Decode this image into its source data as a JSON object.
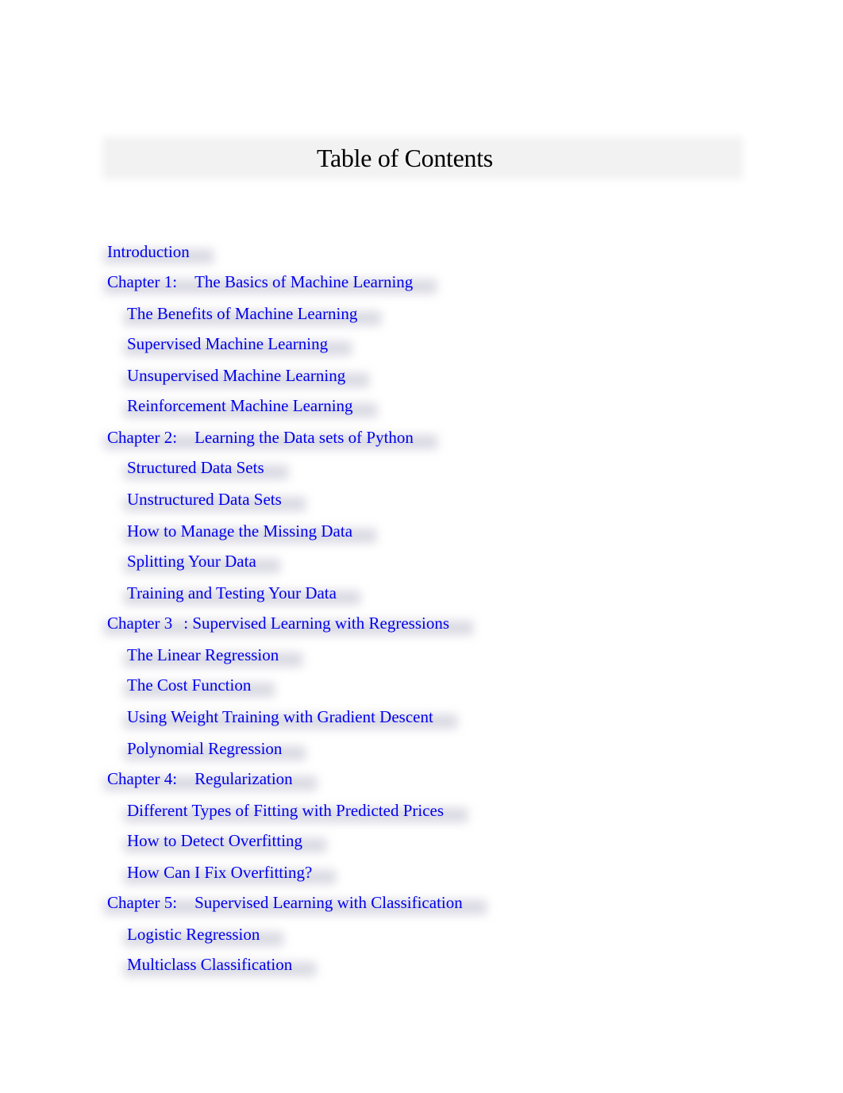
{
  "title": "Table of Contents",
  "link_color": "#0000ee",
  "entries": [
    {
      "level": 1,
      "label": "Introduction"
    },
    {
      "level": 1,
      "prefix": "Chapter 1:",
      "label": "The Basics of Machine Learning"
    },
    {
      "level": 2,
      "label": "The Benefits of Machine Learning"
    },
    {
      "level": 2,
      "label": "Supervised Machine Learning"
    },
    {
      "level": 2,
      "label": "Unsupervised Machine Learning"
    },
    {
      "level": 2,
      "label": "Reinforcement Machine Learning"
    },
    {
      "level": 1,
      "prefix": "Chapter 2:",
      "label": "Learning the Data sets of Python"
    },
    {
      "level": 2,
      "label": "Structured Data Sets"
    },
    {
      "level": 2,
      "label": "Unstructured Data Sets"
    },
    {
      "level": 2,
      "label": "How to Manage the Missing Data"
    },
    {
      "level": 2,
      "label": "Splitting Your Data"
    },
    {
      "level": 2,
      "label": "Training and Testing Your Data"
    },
    {
      "level": 1,
      "prefix": "Chapter 3",
      "label": ": Supervised Learning with Regressions"
    },
    {
      "level": 2,
      "label": "The Linear Regression"
    },
    {
      "level": 2,
      "label": "The Cost Function"
    },
    {
      "level": 2,
      "label": "Using Weight Training with Gradient Descent"
    },
    {
      "level": 2,
      "label": "Polynomial Regression"
    },
    {
      "level": 1,
      "prefix": "Chapter 4:",
      "label": "Regularization"
    },
    {
      "level": 2,
      "label": "Different Types of Fitting with Predicted Prices"
    },
    {
      "level": 2,
      "label": "How to Detect Overfitting"
    },
    {
      "level": 2,
      "label": "How Can I Fix Overfitting?"
    },
    {
      "level": 1,
      "prefix": "Chapter 5:",
      "label": "Supervised Learning with Classification"
    },
    {
      "level": 2,
      "label": "Logistic Regression"
    },
    {
      "level": 2,
      "label": "Multiclass Classification"
    }
  ]
}
